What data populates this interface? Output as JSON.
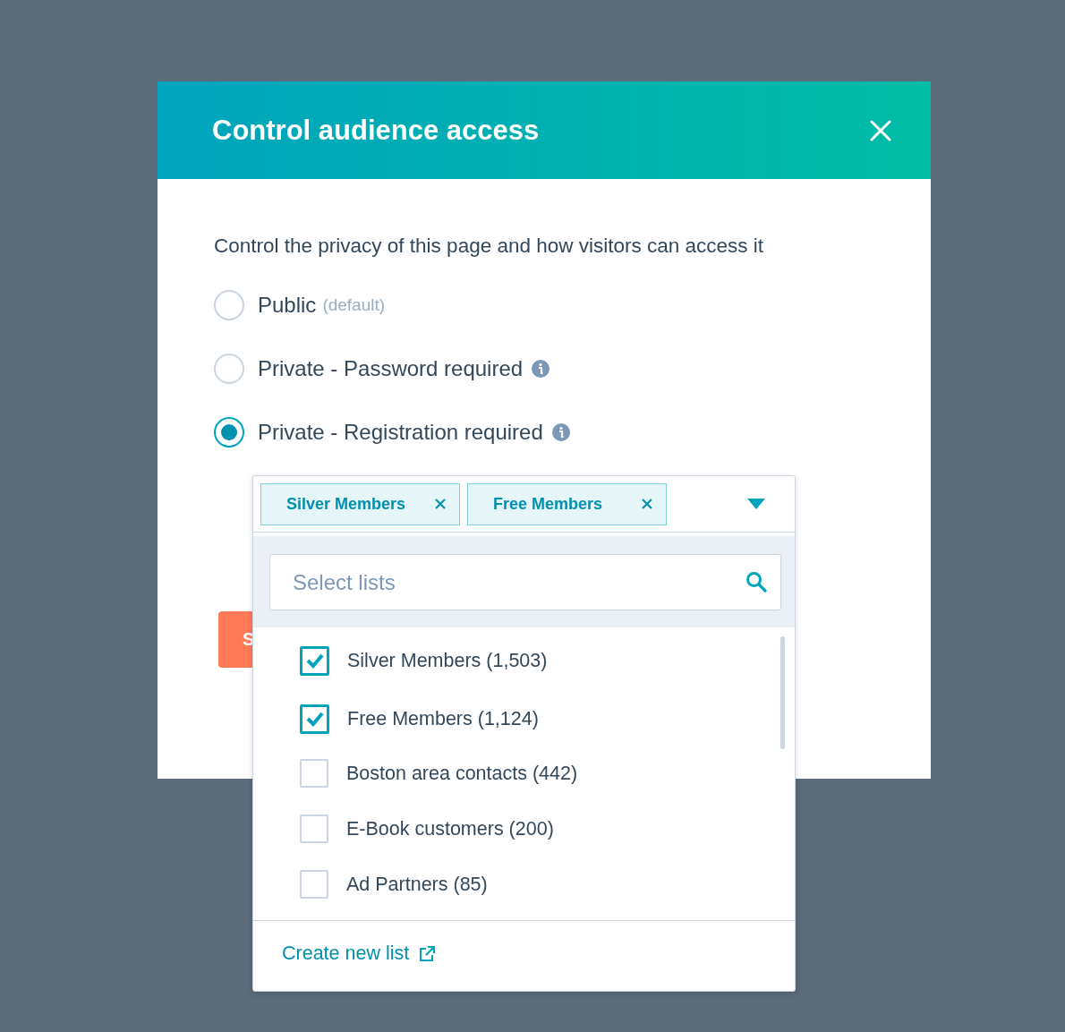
{
  "dialog": {
    "title": "Control audience access",
    "description": "Control the privacy of this page and how visitors can access it",
    "options": [
      {
        "label": "Public",
        "note": "(default)",
        "info": false,
        "selected": false
      },
      {
        "label": "Private - Password required",
        "info": true,
        "selected": false
      },
      {
        "label": "Private - Registration required",
        "info": true,
        "selected": true
      }
    ],
    "button": {
      "label": "S"
    }
  },
  "list_select": {
    "tags": [
      {
        "label": "Silver Members"
      },
      {
        "label": "Free Members"
      }
    ],
    "search": {
      "placeholder": "Select lists"
    },
    "items": [
      {
        "label": "Silver Members (1,503)",
        "checked": true
      },
      {
        "label": "Free Members (1,124)",
        "checked": true
      },
      {
        "label": "Boston area contacts (442)",
        "checked": false
      },
      {
        "label": "E-Book customers (200)",
        "checked": false
      },
      {
        "label": "Ad Partners (85)",
        "checked": false
      }
    ],
    "footer_link": "Create new list"
  }
}
